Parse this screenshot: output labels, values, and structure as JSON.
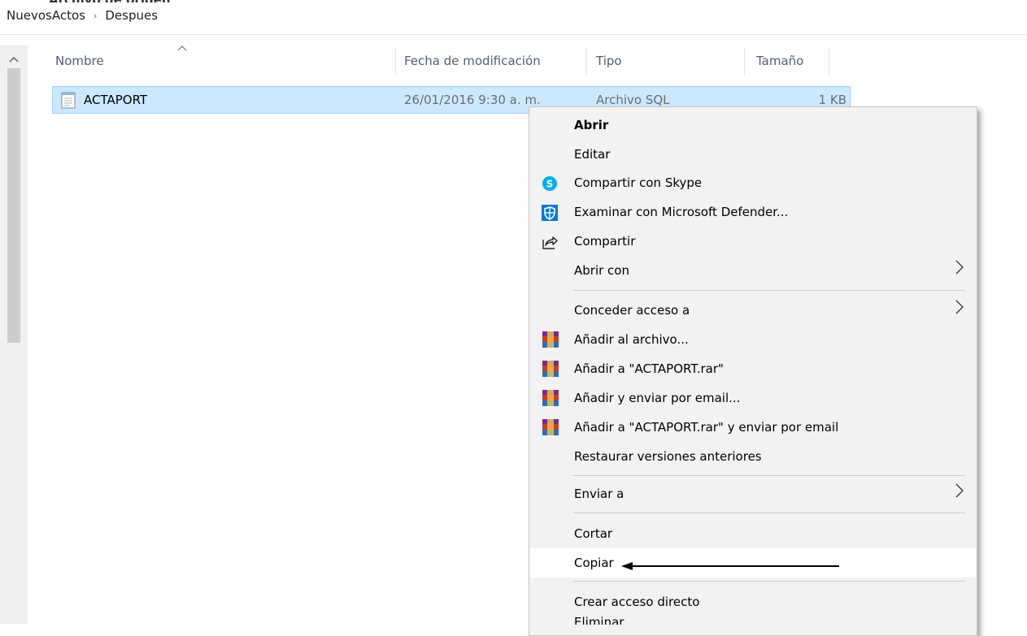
{
  "breadcrumb": {
    "items": [
      "NuevosActos",
      "Despues"
    ],
    "separator": "›"
  },
  "columns": {
    "name": "Nombre",
    "date": "Fecha de modificación",
    "type": "Tipo",
    "size": "Tamaño"
  },
  "file": {
    "name": "ACTAPORT",
    "date": "26/01/2016 9:30 a. m.",
    "type": "Archivo SQL",
    "size": "1 KB"
  },
  "context_menu": {
    "open": "Abrir",
    "edit": "Editar",
    "share_skype": "Compartir con Skype",
    "scan_defender": "Examinar con Microsoft Defender...",
    "share": "Compartir",
    "open_with": "Abrir con",
    "give_access": "Conceder acceso a",
    "add_archive": "Añadir al archivo...",
    "add_rar": "Añadir a \"ACTAPORT.rar\"",
    "add_email": "Añadir y enviar por email...",
    "add_rar_email": "Añadir a \"ACTAPORT.rar\" y enviar por email",
    "restore": "Restaurar versiones anteriores",
    "send_to": "Enviar a",
    "cut": "Cortar",
    "copy": "Copiar",
    "create_shortcut": "Crear acceso directo",
    "delete_partial": "Eliminar"
  },
  "icons": {
    "skype": "skype-icon",
    "defender": "defender-shield-icon",
    "share": "share-icon",
    "winrar": "winrar-icon",
    "file": "sql-file-icon"
  },
  "colors": {
    "selection": "#cce8ff",
    "selection_border": "#99d1ff",
    "menu_bg": "#f2f2f2",
    "skype": "#00aff0",
    "defender": "#0078d7"
  }
}
